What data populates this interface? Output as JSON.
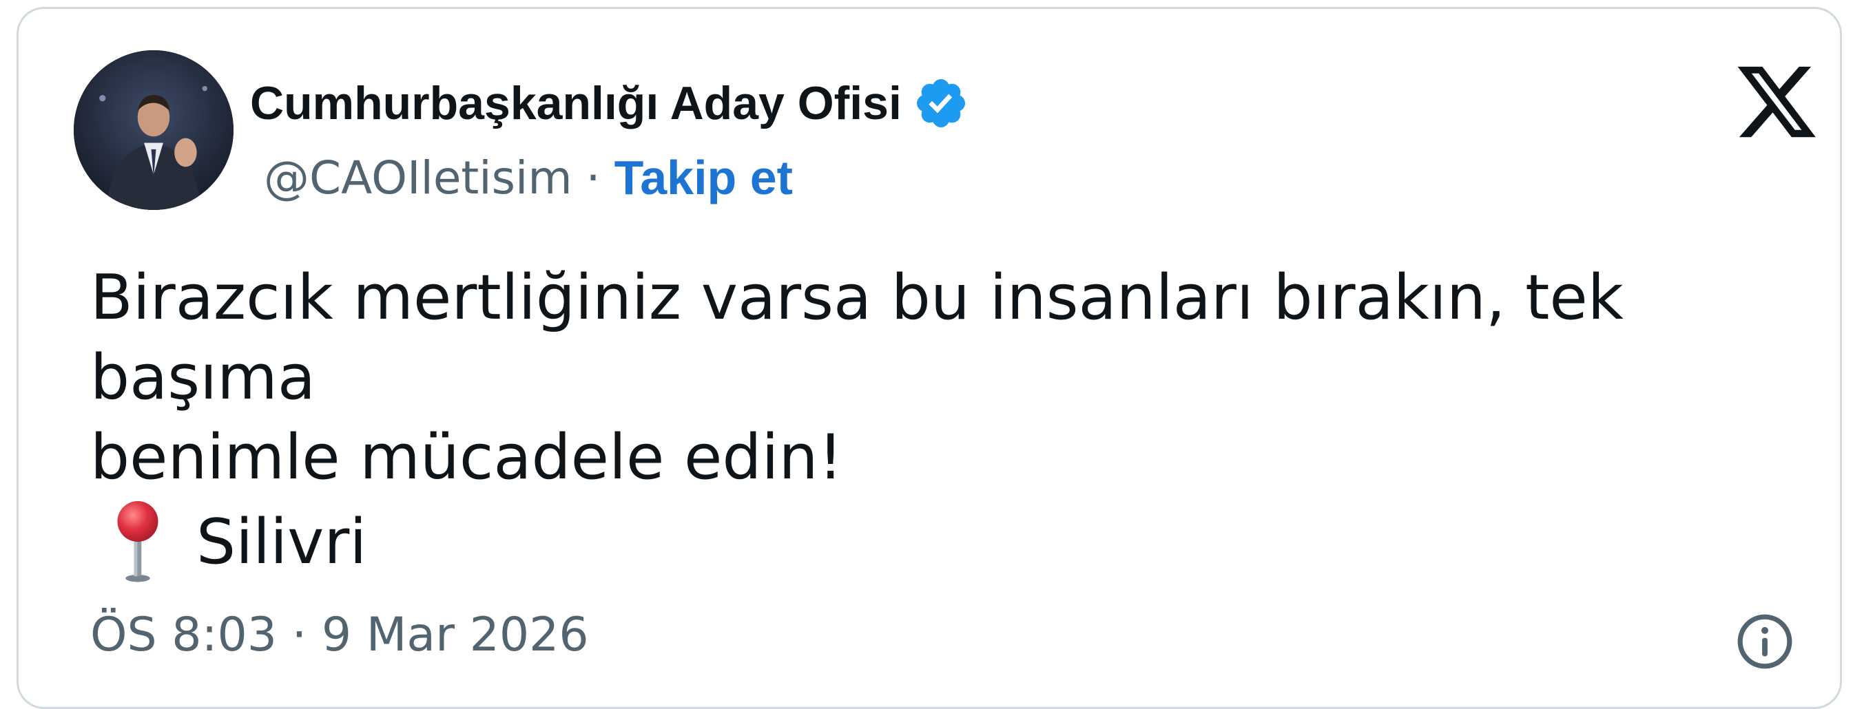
{
  "account": {
    "display_name": "Cumhurbaşkanlığı Aday Ofisi",
    "verified_icon": "verified-badge-icon",
    "handle": "@CAOIletisim",
    "separator": "·",
    "follow_label": "Takip et"
  },
  "platform": {
    "logo_icon": "x-logo-icon"
  },
  "tweet": {
    "text": "Birazcık mertliğiniz varsa bu insanları bırakın, tek başıma\nbenimle mücadele edin!",
    "location_icon": "round-pushpin-icon",
    "location": "Silivri",
    "timestamp": "ÖS 8:03 · 9 Mar 2026",
    "info_icon": "info-icon"
  },
  "colors": {
    "text": "#0f1419",
    "muted": "#536471",
    "link": "#1d74d3",
    "verified": "#1d9bf0",
    "border": "#cfd9de"
  }
}
